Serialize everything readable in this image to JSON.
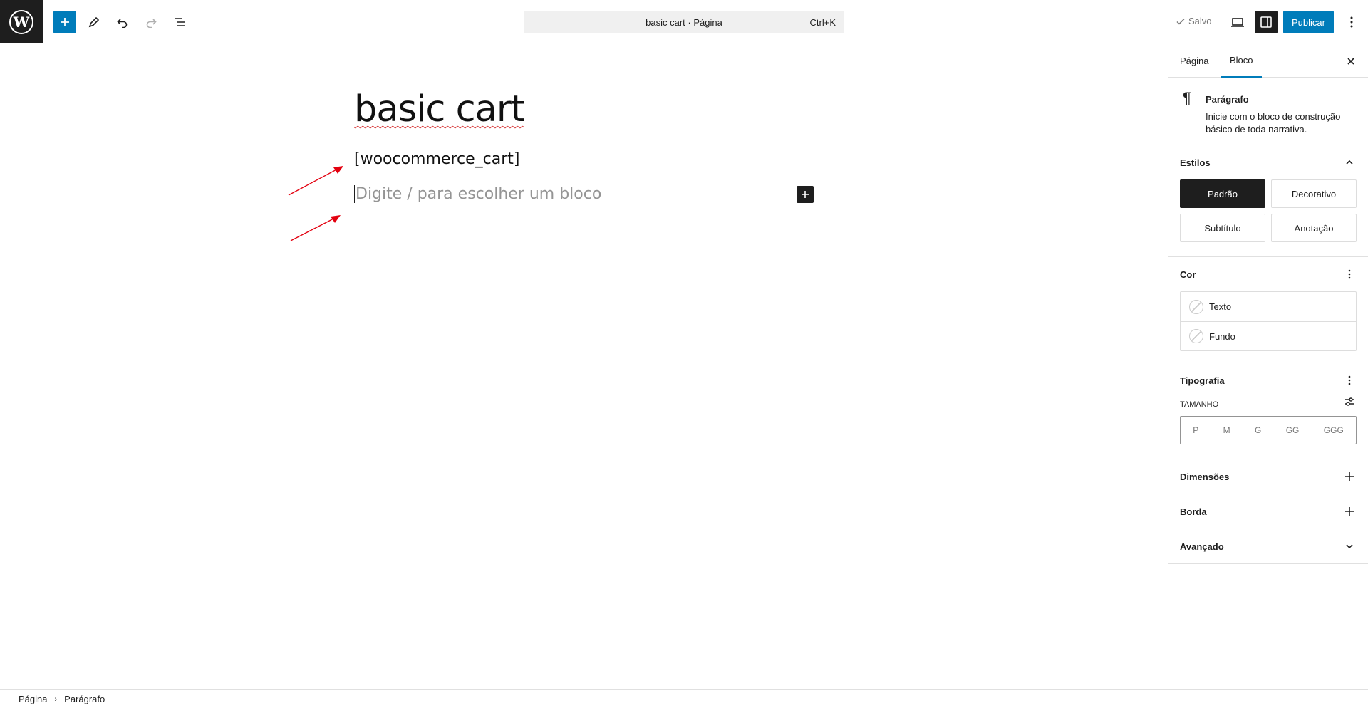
{
  "topbar": {
    "command_title": "basic cart · Página",
    "command_shortcut": "Ctrl+K",
    "saved_label": "Salvo",
    "publish_label": "Publicar"
  },
  "canvas": {
    "title": "basic cart",
    "shortcode": "[woocommerce_cart]",
    "placeholder": "Digite / para escolher um bloco"
  },
  "sidebar": {
    "tabs": [
      "Página",
      "Bloco"
    ],
    "block": {
      "name": "Parágrafo",
      "description": "Inicie com o bloco de construção básico de toda narrativa."
    },
    "styles": {
      "title": "Estilos",
      "options": [
        "Padrão",
        "Decorativo",
        "Subtítulo",
        "Anotação"
      ],
      "active": "Padrão"
    },
    "color": {
      "title": "Cor",
      "items": [
        "Texto",
        "Fundo"
      ]
    },
    "typography": {
      "title": "Tipografia",
      "size_label": "TAMANHO",
      "sizes": [
        "P",
        "M",
        "G",
        "GG",
        "GGG"
      ]
    },
    "dimensions_title": "Dimensões",
    "border_title": "Borda",
    "advanced_title": "Avançado"
  },
  "footer": {
    "breadcrumbs": [
      "Página",
      "Parágrafo"
    ]
  },
  "colors": {
    "accent": "#007cba",
    "dark": "#1e1e1e",
    "annotation_arrow": "#e3000f",
    "spellcheck": "#d63638"
  }
}
